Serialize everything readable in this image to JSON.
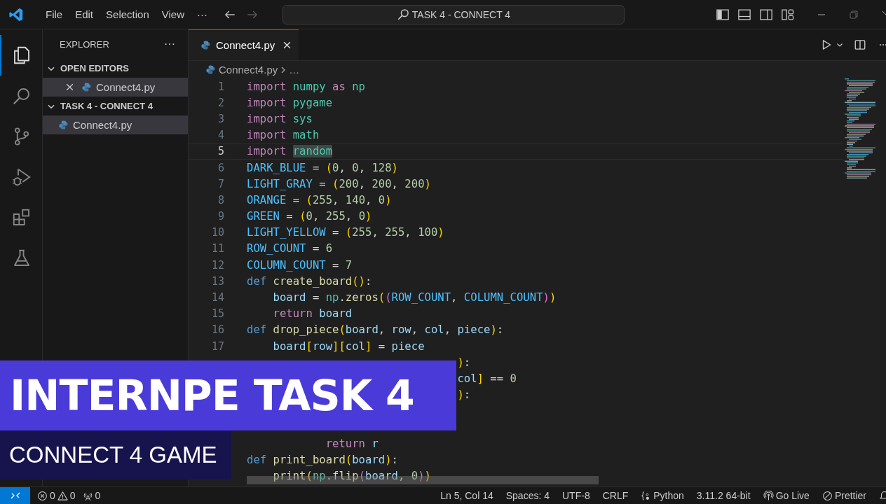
{
  "title_bar": {
    "menu": [
      "File",
      "Edit",
      "Selection",
      "View"
    ],
    "more": "···",
    "search": {
      "value": "TASK 4 - CONNECT 4"
    }
  },
  "activity_bar": [
    {
      "kind": "explorer",
      "selected": true
    },
    {
      "kind": "search",
      "selected": false
    },
    {
      "kind": "source-control",
      "selected": false
    },
    {
      "kind": "run-debug",
      "selected": false
    },
    {
      "kind": "extensions",
      "selected": false
    },
    {
      "kind": "testing",
      "selected": false
    }
  ],
  "sidebar": {
    "title": "EXPLORER",
    "more": "···",
    "sections": [
      {
        "title": "OPEN EDITORS",
        "expanded": true,
        "files": [
          {
            "name": "Connect4.py",
            "selected": true,
            "closable": true
          }
        ]
      },
      {
        "title": "TASK 4 - CONNECT 4",
        "expanded": true,
        "files": [
          {
            "name": "Connect4.py",
            "selected": true,
            "closable": false
          }
        ]
      }
    ]
  },
  "tabs": [
    {
      "label": "Connect4.py",
      "selected": true
    }
  ],
  "breadcrumb": [
    "Connect4.py",
    "…"
  ],
  "editor": {
    "lines": [
      {
        "number": "1",
        "current": false,
        "tokens": [
          {
            "kind": "kw",
            "text": "import "
          },
          {
            "kind": "mod",
            "text": "numpy "
          },
          {
            "kind": "kw",
            "text": "as "
          },
          {
            "kind": "mod",
            "text": "np"
          }
        ]
      },
      {
        "number": "2",
        "current": false,
        "tokens": [
          {
            "kind": "kw",
            "text": "import "
          },
          {
            "kind": "mod",
            "text": "pygame"
          }
        ]
      },
      {
        "number": "3",
        "current": false,
        "tokens": [
          {
            "kind": "kw",
            "text": "import "
          },
          {
            "kind": "mod",
            "text": "sys"
          }
        ]
      },
      {
        "number": "4",
        "current": false,
        "tokens": [
          {
            "kind": "kw",
            "text": "import "
          },
          {
            "kind": "mod",
            "text": "math"
          }
        ]
      },
      {
        "number": "5",
        "current": true,
        "tokens": [
          {
            "kind": "kw",
            "text": "import "
          },
          {
            "kind": "match",
            "text": "random"
          }
        ]
      },
      {
        "number": "6",
        "current": false,
        "tokens": [
          {
            "kind": "const",
            "text": "DARK_BLUE"
          },
          {
            "kind": "plain",
            "text": " = "
          },
          {
            "kind": "paren",
            "text": "("
          },
          {
            "kind": "num",
            "text": "0"
          },
          {
            "kind": "plain",
            "text": ", "
          },
          {
            "kind": "num",
            "text": "0"
          },
          {
            "kind": "plain",
            "text": ", "
          },
          {
            "kind": "num",
            "text": "128"
          },
          {
            "kind": "paren",
            "text": ")"
          }
        ]
      },
      {
        "number": "7",
        "current": false,
        "tokens": [
          {
            "kind": "const",
            "text": "LIGHT_GRAY"
          },
          {
            "kind": "plain",
            "text": " = "
          },
          {
            "kind": "paren",
            "text": "("
          },
          {
            "kind": "num",
            "text": "200"
          },
          {
            "kind": "plain",
            "text": ", "
          },
          {
            "kind": "num",
            "text": "200"
          },
          {
            "kind": "plain",
            "text": ", "
          },
          {
            "kind": "num",
            "text": "200"
          },
          {
            "kind": "paren",
            "text": ")"
          }
        ]
      },
      {
        "number": "8",
        "current": false,
        "tokens": [
          {
            "kind": "const",
            "text": "ORANGE"
          },
          {
            "kind": "plain",
            "text": " = "
          },
          {
            "kind": "paren",
            "text": "("
          },
          {
            "kind": "num",
            "text": "255"
          },
          {
            "kind": "plain",
            "text": ", "
          },
          {
            "kind": "num",
            "text": "140"
          },
          {
            "kind": "plain",
            "text": ", "
          },
          {
            "kind": "num",
            "text": "0"
          },
          {
            "kind": "paren",
            "text": ")"
          }
        ]
      },
      {
        "number": "9",
        "current": false,
        "tokens": [
          {
            "kind": "const",
            "text": "GREEN"
          },
          {
            "kind": "plain",
            "text": " = "
          },
          {
            "kind": "paren",
            "text": "("
          },
          {
            "kind": "num",
            "text": "0"
          },
          {
            "kind": "plain",
            "text": ", "
          },
          {
            "kind": "num",
            "text": "255"
          },
          {
            "kind": "plain",
            "text": ", "
          },
          {
            "kind": "num",
            "text": "0"
          },
          {
            "kind": "paren",
            "text": ")"
          }
        ]
      },
      {
        "number": "10",
        "current": false,
        "tokens": [
          {
            "kind": "const",
            "text": "LIGHT_YELLOW"
          },
          {
            "kind": "plain",
            "text": " = "
          },
          {
            "kind": "paren",
            "text": "("
          },
          {
            "kind": "num",
            "text": "255"
          },
          {
            "kind": "plain",
            "text": ", "
          },
          {
            "kind": "num",
            "text": "255"
          },
          {
            "kind": "plain",
            "text": ", "
          },
          {
            "kind": "num",
            "text": "100"
          },
          {
            "kind": "paren",
            "text": ")"
          }
        ]
      },
      {
        "number": "11",
        "current": false,
        "tokens": [
          {
            "kind": "const",
            "text": "ROW_COUNT"
          },
          {
            "kind": "plain",
            "text": " = "
          },
          {
            "kind": "num",
            "text": "6"
          }
        ]
      },
      {
        "number": "12",
        "current": false,
        "tokens": [
          {
            "kind": "const",
            "text": "COLUMN_COUNT"
          },
          {
            "kind": "plain",
            "text": " = "
          },
          {
            "kind": "num",
            "text": "7"
          }
        ]
      },
      {
        "number": "13",
        "current": false,
        "tokens": [
          {
            "kind": "def",
            "text": "def "
          },
          {
            "kind": "fn",
            "text": "create_board"
          },
          {
            "kind": "paren",
            "text": "()"
          },
          {
            "kind": "plain",
            "text": ":"
          }
        ]
      },
      {
        "number": "14",
        "current": false,
        "tokens": [
          {
            "kind": "var",
            "text": "    board"
          },
          {
            "kind": "plain",
            "text": " = "
          },
          {
            "kind": "mod",
            "text": "np"
          },
          {
            "kind": "plain",
            "text": "."
          },
          {
            "kind": "fn",
            "text": "zeros"
          },
          {
            "kind": "paren",
            "text": "("
          },
          {
            "kind": "paren2",
            "text": "("
          },
          {
            "kind": "const",
            "text": "ROW_COUNT"
          },
          {
            "kind": "plain",
            "text": ", "
          },
          {
            "kind": "const",
            "text": "COLUMN_COUNT"
          },
          {
            "kind": "paren2",
            "text": ")"
          },
          {
            "kind": "paren",
            "text": ")"
          }
        ]
      },
      {
        "number": "15",
        "current": false,
        "tokens": [
          {
            "kind": "kw",
            "text": "    return "
          },
          {
            "kind": "var",
            "text": "board"
          }
        ]
      },
      {
        "number": "16",
        "current": false,
        "tokens": [
          {
            "kind": "def",
            "text": "def "
          },
          {
            "kind": "fn",
            "text": "drop_piece"
          },
          {
            "kind": "paren",
            "text": "("
          },
          {
            "kind": "var",
            "text": "board"
          },
          {
            "kind": "plain",
            "text": ", "
          },
          {
            "kind": "var",
            "text": "row"
          },
          {
            "kind": "plain",
            "text": ", "
          },
          {
            "kind": "var",
            "text": "col"
          },
          {
            "kind": "plain",
            "text": ", "
          },
          {
            "kind": "var",
            "text": "piece"
          },
          {
            "kind": "paren",
            "text": ")"
          },
          {
            "kind": "plain",
            "text": ":"
          }
        ]
      },
      {
        "number": "17",
        "current": false,
        "tokens": [
          {
            "kind": "var",
            "text": "    board"
          },
          {
            "kind": "paren",
            "text": "["
          },
          {
            "kind": "var",
            "text": "row"
          },
          {
            "kind": "paren",
            "text": "]"
          },
          {
            "kind": "paren",
            "text": "["
          },
          {
            "kind": "var",
            "text": "col"
          },
          {
            "kind": "paren",
            "text": "]"
          },
          {
            "kind": "plain",
            "text": " = "
          },
          {
            "kind": "var",
            "text": "piece"
          }
        ]
      },
      {
        "current": false,
        "tokens": [
          {
            "kind": "paren",
            "text": "                                )"
          },
          {
            "kind": "plain",
            "text": ":"
          }
        ]
      },
      {
        "current": false,
        "tokens": [
          {
            "kind": "var",
            "text": "                                col"
          },
          {
            "kind": "paren",
            "text": "]"
          },
          {
            "kind": "plain",
            "text": " == "
          },
          {
            "kind": "num",
            "text": "0"
          }
        ]
      },
      {
        "current": false,
        "tokens": [
          {
            "kind": "paren",
            "text": "                                )"
          },
          {
            "kind": "plain",
            "text": ":"
          }
        ]
      },
      {
        "current": false
      },
      {
        "current": false
      },
      {
        "current": false,
        "tokens": [
          {
            "kind": "kw",
            "text": "            return "
          },
          {
            "kind": "var",
            "text": "r"
          }
        ]
      },
      {
        "current": false,
        "tokens": [
          {
            "kind": "def",
            "text": "def "
          },
          {
            "kind": "fn",
            "text": "print_board"
          },
          {
            "kind": "paren",
            "text": "("
          },
          {
            "kind": "var",
            "text": "board"
          },
          {
            "kind": "paren",
            "text": ")"
          },
          {
            "kind": "plain",
            "text": ":"
          }
        ]
      },
      {
        "current": false,
        "tokens": [
          {
            "kind": "fn",
            "text": "    print"
          },
          {
            "kind": "paren",
            "text": "("
          },
          {
            "kind": "mod",
            "text": "np"
          },
          {
            "kind": "plain",
            "text": "."
          },
          {
            "kind": "fn",
            "text": "flip"
          },
          {
            "kind": "paren2",
            "text": "("
          },
          {
            "kind": "var",
            "text": "board"
          },
          {
            "kind": "plain",
            "text": ", "
          },
          {
            "kind": "num",
            "text": "0"
          },
          {
            "kind": "paren2",
            "text": ")"
          },
          {
            "kind": "paren",
            "text": ")"
          }
        ]
      }
    ]
  },
  "overlay": {
    "title": "INTERNPE TASK 4",
    "subtitle": "CONNECT 4 GAME"
  },
  "status_bar": {
    "errors": "0",
    "warnings": "0",
    "ports": "0",
    "items": [
      {
        "kind": "plain",
        "text": "Ln 5, Col 14"
      },
      {
        "kind": "plain",
        "text": "Spaces: 4"
      },
      {
        "kind": "plain",
        "text": "UTF-8"
      },
      {
        "kind": "plain",
        "text": "CRLF"
      },
      {
        "kind": "language",
        "text": "Python"
      },
      {
        "kind": "plain",
        "text": "3.11.2 64-bit"
      },
      {
        "kind": "live",
        "text": "Go Live"
      },
      {
        "kind": "prettier",
        "text": "Prettier"
      }
    ]
  }
}
